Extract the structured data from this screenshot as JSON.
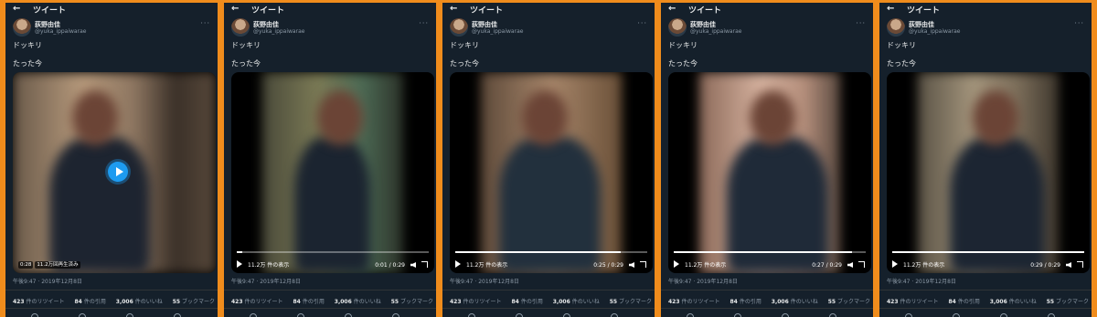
{
  "header": {
    "back_icon": "arrow-left-icon",
    "title": "ツイート"
  },
  "user": {
    "name": "荻野由佳",
    "handle": "@yuka_ippaiwarae",
    "more_icon": "more-icon"
  },
  "tweet": {
    "line1": "ドッキリ",
    "line2": "たった今"
  },
  "timestamp": "午後9:47 · 2019年12月8日",
  "stats": {
    "retweets_count": "423",
    "retweets_label": "件のリツイート",
    "quotes_count": "84",
    "quotes_label": "件の引用",
    "likes_count": "3,006",
    "likes_label": "件のいいね",
    "bookmarks_count": "55",
    "bookmarks_label": "ブックマーク"
  },
  "panels": [
    {
      "mode": "thumbnail",
      "duration": "0:28",
      "views_badge": "11.2万回再生済み"
    },
    {
      "mode": "playing",
      "views": "11.2万 件の表示",
      "time": "0:01 / 0:29",
      "progress": 0.03
    },
    {
      "mode": "playing",
      "views": "11.2万 件の表示",
      "time": "0:25 / 0:29",
      "progress": 0.86
    },
    {
      "mode": "playing",
      "views": "11.2万 件の表示",
      "time": "0:27 / 0:29",
      "progress": 0.93
    },
    {
      "mode": "playing",
      "views": "11.2万 件の表示",
      "time": "0:29 / 0:29",
      "progress": 1.0
    }
  ],
  "colors": {
    "border": "#f08c1c",
    "background": "#15202b",
    "accent": "#1d9bf0"
  }
}
